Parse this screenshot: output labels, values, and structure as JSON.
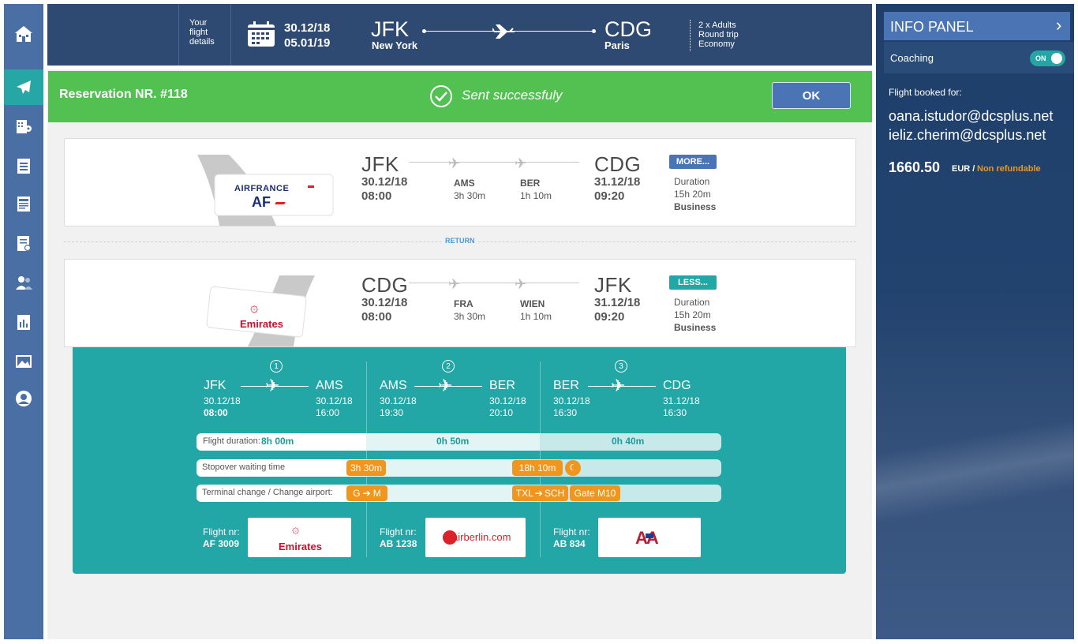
{
  "header": {
    "your_flight_details": [
      "Your",
      "flight",
      "details"
    ],
    "date_out": "30.12/18",
    "date_back": "05.01/19",
    "from_code": "JFK",
    "from_city": "New York",
    "to_code": "CDG",
    "to_city": "Paris",
    "passengers": "2 x Adults",
    "trip_type": "Round trip",
    "cabin": "Economy"
  },
  "sidebar": {
    "items": [
      "home-icon",
      "plane-icon",
      "hotel-icon",
      "checklist-icon",
      "document-icon",
      "report-icon",
      "users-icon",
      "chart-icon",
      "image-icon",
      "user-circle-icon"
    ],
    "active": "plane-icon"
  },
  "success": {
    "reservation": "Reservation NR. #118",
    "message": "Sent successfuly",
    "ok_label": "OK"
  },
  "outbound": {
    "airline": "AIRFRANCE",
    "airline_short": "AF",
    "from": "JFK",
    "from_date": "30.12/18",
    "from_time": "08:00",
    "stop1": "AMS",
    "stop1_time": "3h 30m",
    "stop2": "BER",
    "stop2_time": "1h 10m",
    "to": "CDG",
    "to_date": "31.12/18",
    "to_time": "09:20",
    "more_label": "MORE...",
    "duration_label": "Duration",
    "duration": "15h 20m",
    "class": "Business"
  },
  "return_label": "RETURN",
  "inbound": {
    "airline": "Emirates",
    "from": "CDG",
    "from_date": "30.12/18",
    "from_time": "08:00",
    "stop1": "FRA",
    "stop1_time": "3h 30m",
    "stop2": "WIEN",
    "stop2_time": "1h 10m",
    "to": "JFK",
    "to_date": "31.12/18",
    "to_time": "09:20",
    "less_label": "LESS...",
    "duration_label": "Duration",
    "duration": "15h 20m",
    "class": "Business"
  },
  "segments": [
    {
      "num": "1",
      "from": "JFK",
      "from_date": "30.12/18",
      "from_time": "08:00",
      "to": "AMS",
      "to_date": "30.12/18",
      "to_time": "16:00",
      "flight_label": "Flight nr:",
      "flight_nr": "AF 3009",
      "logo": "Emirates"
    },
    {
      "num": "2",
      "from": "AMS",
      "from_date": "30.12/18",
      "from_time": "19:30",
      "to": "BER",
      "to_date": "30.12/18",
      "to_time": "20:10",
      "flight_label": "Flight nr:",
      "flight_nr": "AB 1238",
      "logo": "airberlin.com"
    },
    {
      "num": "3",
      "from": "BER",
      "from_date": "30.12/18",
      "from_time": "16:30",
      "to": "CDG",
      "to_date": "31.12/18",
      "to_time": "16:30",
      "flight_label": "Flight nr:",
      "flight_nr": "AB 834",
      "logo": "AA"
    }
  ],
  "timeline": {
    "duration_label": "Flight duration:",
    "duration_value": "8h 00m",
    "seg2_duration": "0h 50m",
    "seg3_duration": "0h 40m",
    "stopover_label": "Stopover waiting time",
    "stopover1": "3h 30m",
    "stopover2": "18h 10m",
    "terminal_label": "Terminal change / Change airport:",
    "terminal1_from": "G",
    "terminal1_to": "M",
    "terminal2_from": "TXL",
    "terminal2_to": "SCH",
    "gate": "Gate M10"
  },
  "panel": {
    "title": "INFO PANEL",
    "coaching_label": "Coaching",
    "toggle_label": "ON",
    "booked_for_label": "Flight booked for:",
    "emails": [
      "oana.istudor@dcsplus.net",
      "ieliz.cherim@dcsplus.net"
    ],
    "price": "1660.50",
    "currency": "EUR /",
    "refund": "Non refundable"
  },
  "colors": {
    "accent_teal": "#22a6a6",
    "success_green": "#52c152",
    "header_navy": "#2e4a72",
    "sidebar_blue": "#4a6fa5",
    "ok_button": "#4a74b4",
    "orange": "#f0961e"
  }
}
